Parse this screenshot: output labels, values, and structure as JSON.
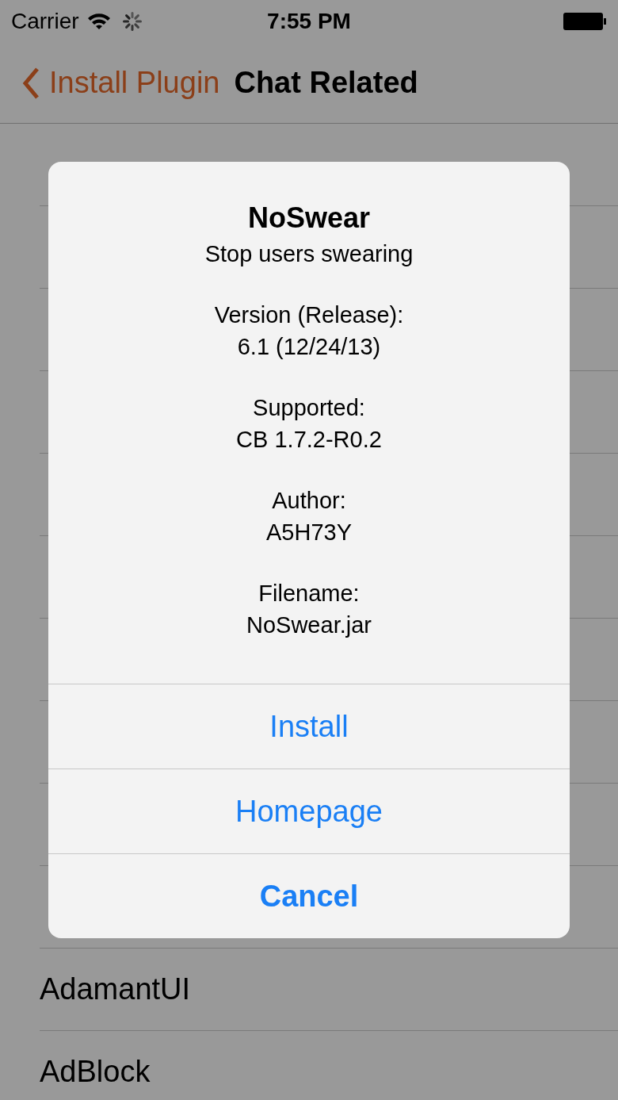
{
  "status_bar": {
    "carrier": "Carrier",
    "time": "7:55 PM"
  },
  "nav_bar": {
    "back": "Install Plugin",
    "title": "Chat Related"
  },
  "list": [
    {
      "label": "AdamantUI"
    },
    {
      "label": "AdBlock"
    }
  ],
  "alert": {
    "title": "NoSwear",
    "subtitle": "Stop users swearing",
    "details": [
      {
        "label": "Version (Release):",
        "value": "6.1 (12/24/13)"
      },
      {
        "label": "Supported:",
        "value": "CB 1.7.2-R0.2"
      },
      {
        "label": "Author:",
        "value": "A5H73Y"
      },
      {
        "label": "Filename:",
        "value": "NoSwear.jar"
      }
    ],
    "buttons": [
      {
        "label": "Install",
        "kind": "action"
      },
      {
        "label": "Homepage",
        "kind": "action"
      },
      {
        "label": "Cancel",
        "kind": "cancel"
      }
    ]
  }
}
